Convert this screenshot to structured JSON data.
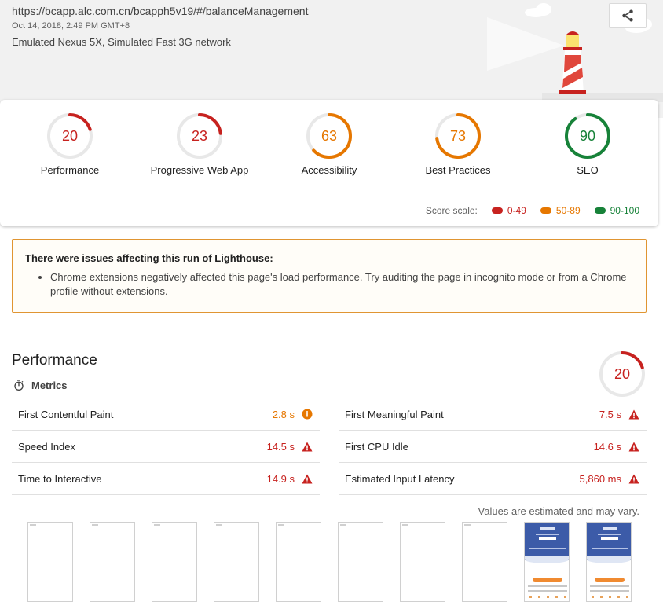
{
  "header": {
    "url": "https://bcapp.alc.com.cn/bcapph5v19/#/balanceManagement",
    "date": "Oct 14, 2018, 2:49 PM GMT+8",
    "environment": "Emulated Nexus 5X, Simulated Fast 3G network",
    "share_icon": "share-icon"
  },
  "scores": [
    {
      "label": "Performance",
      "value": "20",
      "score": 20,
      "color": "#c7221f"
    },
    {
      "label": "Progressive Web App",
      "value": "23",
      "score": 23,
      "color": "#c7221f"
    },
    {
      "label": "Accessibility",
      "value": "63",
      "score": 63,
      "color": "#e67700"
    },
    {
      "label": "Best Practices",
      "value": "73",
      "score": 73,
      "color": "#e67700"
    },
    {
      "label": "SEO",
      "value": "90",
      "score": 90,
      "color": "#178239"
    }
  ],
  "score_scale": {
    "label": "Score scale:",
    "ranges": [
      {
        "text": "0-49",
        "color": "#c7221f"
      },
      {
        "text": "50-89",
        "color": "#e67700"
      },
      {
        "text": "90-100",
        "color": "#178239"
      }
    ]
  },
  "warning": {
    "title": "There were issues affecting this run of Lighthouse:",
    "items": [
      "Chrome extensions negatively affected this page's load performance. Try auditing the page in incognito mode or from a Chrome profile without extensions."
    ]
  },
  "performance": {
    "title": "Performance",
    "score": "20",
    "score_value": 20,
    "metrics_label": "Metrics",
    "metrics": [
      {
        "name": "First Contentful Paint",
        "value": "2.8 s",
        "status": "average",
        "icon": "info-icon"
      },
      {
        "name": "First Meaningful Paint",
        "value": "7.5 s",
        "status": "fail",
        "icon": "warning-icon"
      },
      {
        "name": "Speed Index",
        "value": "14.5 s",
        "status": "fail",
        "icon": "warning-icon"
      },
      {
        "name": "First CPU Idle",
        "value": "14.6 s",
        "status": "fail",
        "icon": "warning-icon"
      },
      {
        "name": "Time to Interactive",
        "value": "14.9 s",
        "status": "fail",
        "icon": "warning-icon"
      },
      {
        "name": "Estimated Input Latency",
        "value": "5,860 ms",
        "status": "fail",
        "icon": "warning-icon"
      }
    ],
    "note": "Values are estimated and may vary.",
    "filmstrip_frames": 10,
    "filmstrip_loaded_from": 8
  }
}
